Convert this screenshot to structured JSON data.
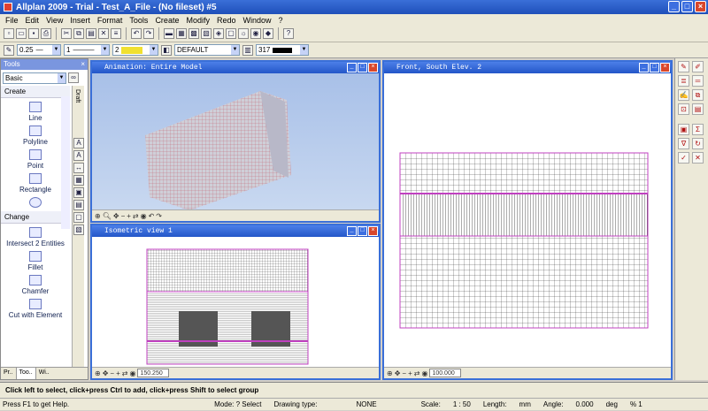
{
  "app": {
    "title": "Allplan 2009 - Trial - Test_A_File - (No fileset) #5"
  },
  "menu": [
    "File",
    "Edit",
    "View",
    "Insert",
    "Format",
    "Tools",
    "Create",
    "Modify",
    "Redo",
    "Window",
    "?"
  ],
  "toolbar2": {
    "pen": "0.25",
    "line": "1",
    "color": "2",
    "layer": "DEFAULT",
    "number": "317"
  },
  "tools": {
    "header": "Tools",
    "module": "Basic",
    "side_tab": "Draft",
    "create_label": "Create",
    "create_items": [
      "Line",
      "Polyline",
      "Point",
      "Rectangle"
    ],
    "change_label": "Change",
    "change_items": [
      "Intersect 2 Entities",
      "Fillet",
      "Chamfer",
      "Cut with Element"
    ],
    "tabs": [
      "Pr..",
      "Too..",
      "Wi.."
    ]
  },
  "windows": {
    "anim": {
      "title": "Animation: Entire Model"
    },
    "iso": {
      "title": "Isometric view 1",
      "scale": "150.250"
    },
    "front": {
      "title": "Front, South Elev. 2",
      "scale": "100.000"
    }
  },
  "prompt": "Click left to select, click+press Ctrl to add, click+press Shift to select group",
  "status": {
    "help": "Press F1 to get Help.",
    "mode": "Mode: ? Select",
    "drawing_type": "Drawing type:",
    "drawing_type_value": "NONE",
    "scale_label": "Scale:",
    "scale": "1 : 50",
    "length_label": "Length:",
    "length_unit": "mm",
    "angle_label": "Angle:",
    "angle": "0.000",
    "angle_unit": "deg",
    "count": "% 1"
  },
  "colors": {
    "accent": "#3a6fd8",
    "facade": "#c040c0"
  }
}
